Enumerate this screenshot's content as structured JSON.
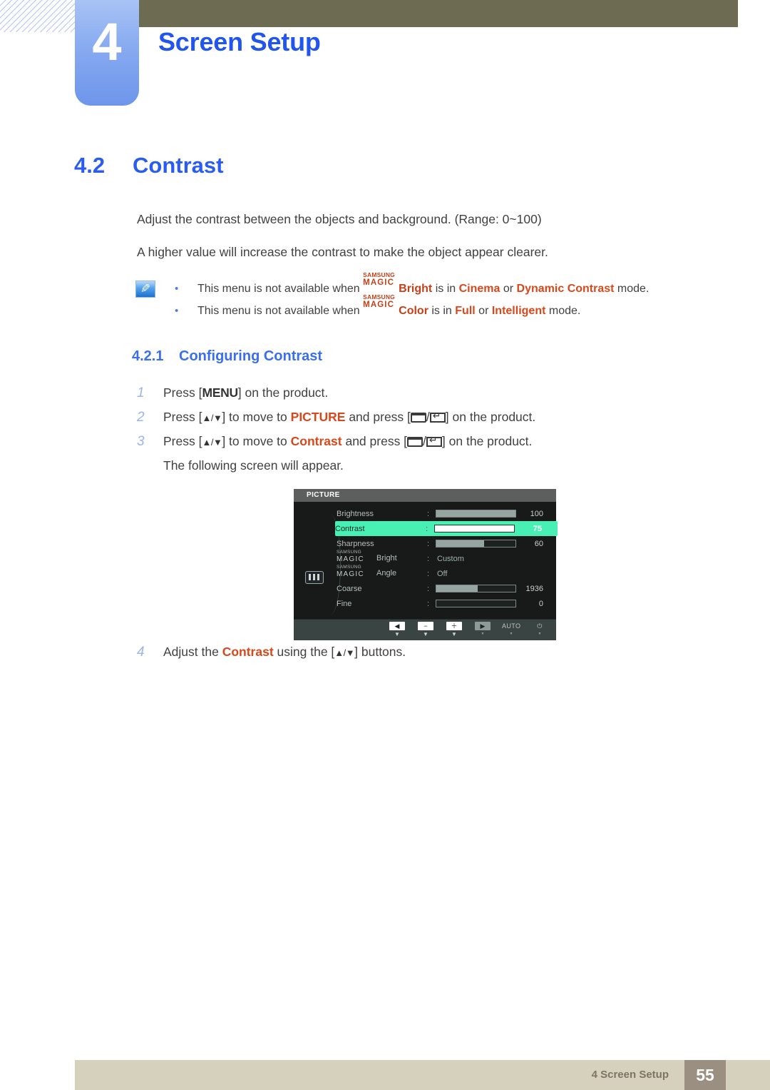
{
  "chapter": {
    "number": "4",
    "title": "Screen Setup"
  },
  "section": {
    "number": "4.2",
    "title": "Contrast"
  },
  "body": {
    "paragraph1": "Adjust the contrast between the objects and background. (Range: 0~100)",
    "paragraph2": "A higher value will increase the contrast to make the object appear clearer."
  },
  "note": {
    "icon": "note-pencil-icon",
    "bullet": "•",
    "brand_top": "SAMSUNG",
    "brand_bottom": "MAGIC",
    "line1": {
      "prefix": "This menu is not available when",
      "brand_word": "Bright",
      "mid": "is in",
      "option1": "Cinema",
      "conj": "or",
      "option2": "Dynamic Contrast",
      "suffix": "mode."
    },
    "line2": {
      "prefix": "This menu is not available when",
      "brand_word": "Color",
      "mid": "is in",
      "option1": "Full",
      "conj": "or",
      "option2": "Intelligent",
      "suffix": "mode."
    }
  },
  "subsection": {
    "number": "4.2.1",
    "title": "Configuring Contrast"
  },
  "steps": {
    "step1": {
      "num": "1",
      "pre": "Press [",
      "key": "MENU",
      "post": "] on the product."
    },
    "step2": {
      "num": "2",
      "pre": "Press [",
      "arrows": "▲/▼",
      "mid": "] to move to",
      "target": "PICTURE",
      "mid2": "and press [",
      "slash": "/",
      "post": "] on the product."
    },
    "step3": {
      "num": "3",
      "pre": "Press [",
      "arrows": "▲/▼",
      "mid": "] to move to",
      "target": "Contrast",
      "mid2": "and press [",
      "slash": "/",
      "post": "] on the product.",
      "followup": "The following screen will appear."
    },
    "step4": {
      "num": "4",
      "pre": "Adjust the",
      "target": "Contrast",
      "mid": "using the [",
      "arrows": "▲/▼",
      "post": "] buttons."
    }
  },
  "osd": {
    "title": "PICTURE",
    "sideicon": "picture-bars-icon",
    "brand_top": "SAMSUNG",
    "brand_bottom": "MAGIC",
    "colon": ":",
    "rows": [
      {
        "label": "Brightness",
        "type": "slider",
        "value": "100",
        "percent": 100
      },
      {
        "label": "Contrast",
        "type": "slider",
        "value": "75",
        "percent": 75,
        "selected": true
      },
      {
        "label": "Sharpness",
        "type": "slider",
        "value": "60",
        "percent": 60
      },
      {
        "label": "Bright",
        "type": "text",
        "value": "Custom",
        "brand": true
      },
      {
        "label": "Angle",
        "type": "text",
        "value": "Off",
        "brand": true
      },
      {
        "label": "Coarse",
        "type": "slider",
        "value": "1936",
        "percent": 52
      },
      {
        "label": "Fine",
        "type": "slider",
        "value": "0",
        "percent": 0
      }
    ],
    "buttons": [
      {
        "name": "nav-left-button",
        "glyph": "◀",
        "style": "box",
        "tri": "▼"
      },
      {
        "name": "decrease-button",
        "glyph": "−",
        "style": "box",
        "tri": "▼"
      },
      {
        "name": "increase-button",
        "glyph": "＋",
        "style": "box",
        "tri": "▼"
      },
      {
        "name": "nav-right-button",
        "glyph": "▶",
        "style": "box-dim",
        "tri": "▼"
      },
      {
        "name": "auto-button",
        "glyph": "AUTO",
        "style": "plain",
        "tri": "▼"
      },
      {
        "name": "power-button",
        "glyph": "⏻",
        "style": "plain",
        "tri": "▼"
      }
    ]
  },
  "footer": {
    "label": "4 Screen Setup",
    "page": "55"
  },
  "colors": {
    "heading_blue": "#2a5dee",
    "accent_red": "#d8481b",
    "brand_orange": "#c4401a",
    "olive_bar": "#6e6b53",
    "footer_beige": "#d6d1bd",
    "footer_page": "#9b8f82",
    "osd_highlight": "#49f0b4"
  }
}
